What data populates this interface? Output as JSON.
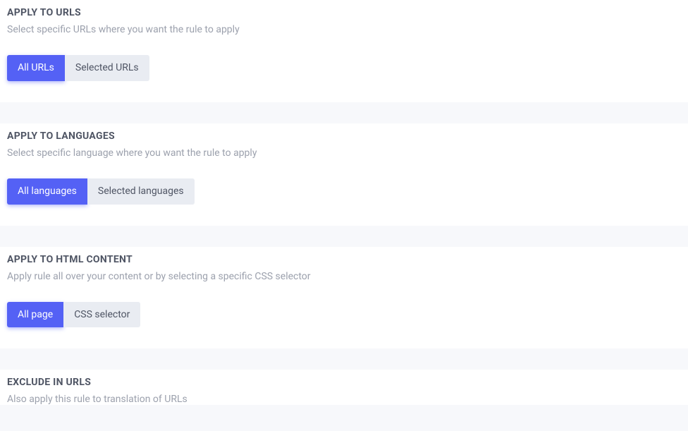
{
  "sections": {
    "urls": {
      "title": "APPLY TO URLS",
      "subtitle": "Select specific URLs where you want the rule to apply",
      "option_active": "All URLs",
      "option_inactive": "Selected URLs"
    },
    "languages": {
      "title": "APPLY TO LANGUAGES",
      "subtitle": "Select specific language where you want the rule to apply",
      "option_active": "All languages",
      "option_inactive": "Selected languages"
    },
    "html": {
      "title": "APPLY TO HTML CONTENT",
      "subtitle": "Apply rule all over your content or by selecting a specific CSS selector",
      "option_active": "All page",
      "option_inactive": "CSS selector"
    },
    "exclude": {
      "title": "EXCLUDE IN URLS",
      "subtitle": "Also apply this rule to translation of URLs"
    }
  }
}
